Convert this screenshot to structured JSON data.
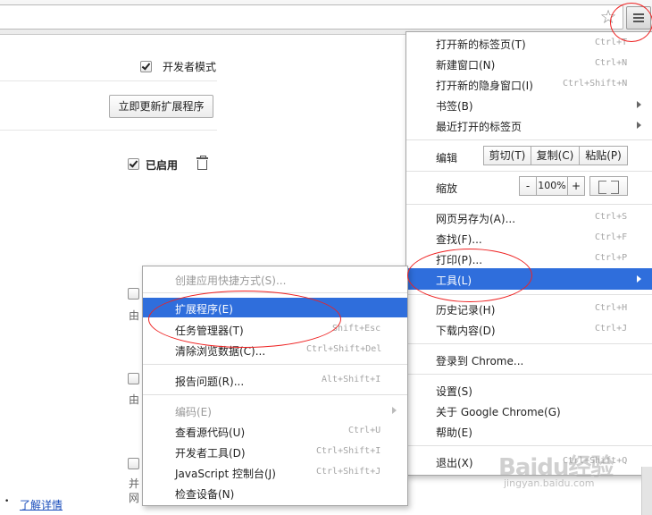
{
  "page": {
    "developer_mode_label": "开发者模式",
    "update_button": "立即更新扩展程序",
    "enabled_label": "已启用",
    "from_text_1": "由",
    "from_text_2": "由",
    "partial_text_3": "并",
    "partial_text_4": "网",
    "learn_more_link": "了解详情"
  },
  "chrome_menu": {
    "items": [
      {
        "label": "打开新的标签页(T)",
        "shortcut": "Ctrl+T"
      },
      {
        "label": "新建窗口(N)",
        "shortcut": "Ctrl+N"
      },
      {
        "label": "打开新的隐身窗口(I)",
        "shortcut": "Ctrl+Shift+N"
      },
      {
        "label": "书签(B)",
        "shortcut": ""
      },
      {
        "label": "最近打开的标签页",
        "shortcut": ""
      }
    ],
    "edit": {
      "label": "编辑",
      "cut": "剪切(T)",
      "copy": "复制(C)",
      "paste": "粘贴(P)"
    },
    "zoom": {
      "label": "缩放",
      "minus": "-",
      "value": "100%",
      "plus": "+"
    },
    "items2": [
      {
        "label": "网页另存为(A)...",
        "shortcut": "Ctrl+S"
      },
      {
        "label": "查找(F)...",
        "shortcut": "Ctrl+F"
      },
      {
        "label": "打印(P)...",
        "shortcut": "Ctrl+P"
      },
      {
        "label": "工具(L)",
        "shortcut": ""
      }
    ],
    "items3": [
      {
        "label": "历史记录(H)",
        "shortcut": "Ctrl+H"
      },
      {
        "label": "下载内容(D)",
        "shortcut": "Ctrl+J"
      }
    ],
    "signin": "登录到 Chrome...",
    "items4": [
      {
        "label": "设置(S)"
      },
      {
        "label": "关于 Google Chrome(G)"
      },
      {
        "label": "帮助(E)"
      }
    ],
    "exit": {
      "label": "退出(X)",
      "shortcut": "Ctrl+Shift+Q"
    }
  },
  "tools_menu": {
    "create_shortcuts": "创建应用快捷方式(S)...",
    "extensions": {
      "label": "扩展程序(E)",
      "shortcut": ""
    },
    "task_manager": {
      "label": "任务管理器(T)",
      "shortcut": "Shift+Esc"
    },
    "clear_data": {
      "label": "清除浏览数据(C)...",
      "shortcut": "Ctrl+Shift+Del"
    },
    "report_issue": {
      "label": "报告问题(R)...",
      "shortcut": "Alt+Shift+I"
    },
    "encoding": {
      "label": "编码(E)",
      "shortcut": ""
    },
    "view_source": {
      "label": "查看源代码(U)",
      "shortcut": "Ctrl+U"
    },
    "dev_tools": {
      "label": "开发者工具(D)",
      "shortcut": "Ctrl+Shift+I"
    },
    "js_console": {
      "label": "JavaScript 控制台(J)",
      "shortcut": "Ctrl+Shift+J"
    },
    "inspect_devices": {
      "label": "检查设备(N)",
      "shortcut": ""
    }
  },
  "watermark": {
    "big": "Baidu经验",
    "small": "jingyan.baidu.com"
  },
  "colors": {
    "highlight": "#2f6edc",
    "annotation": "#e22222",
    "link": "#1a4dbb"
  }
}
